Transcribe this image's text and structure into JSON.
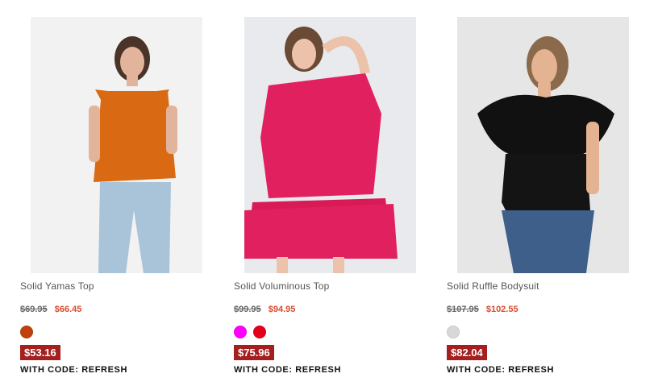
{
  "products": [
    {
      "name": "Solid Yamas Top",
      "old_price": "$69.95",
      "new_price": "$66.45",
      "swatches": [
        "#c0410f"
      ],
      "promo_price": "$53.16",
      "promo_code": "WITH CODE: REFRESH"
    },
    {
      "name": "Solid Voluminous Top",
      "old_price": "$99.95",
      "new_price": "$94.95",
      "swatches": [
        "#ff00ff",
        "#e3001b"
      ],
      "promo_price": "$75.96",
      "promo_code": "WITH CODE: REFRESH"
    },
    {
      "name": "Solid Ruffle Bodysuit",
      "old_price": "$107.95",
      "new_price": "$102.55",
      "swatches": [
        "#d8d8d8"
      ],
      "promo_price": "$82.04",
      "promo_code": "WITH CODE: REFRESH"
    }
  ],
  "colors": {
    "sale": "#d94b2b",
    "badge": "#a61f1f",
    "top1": "#d96a13",
    "top2": "#e1215f",
    "top3": "#111111",
    "denim": "#a9c3d9"
  }
}
